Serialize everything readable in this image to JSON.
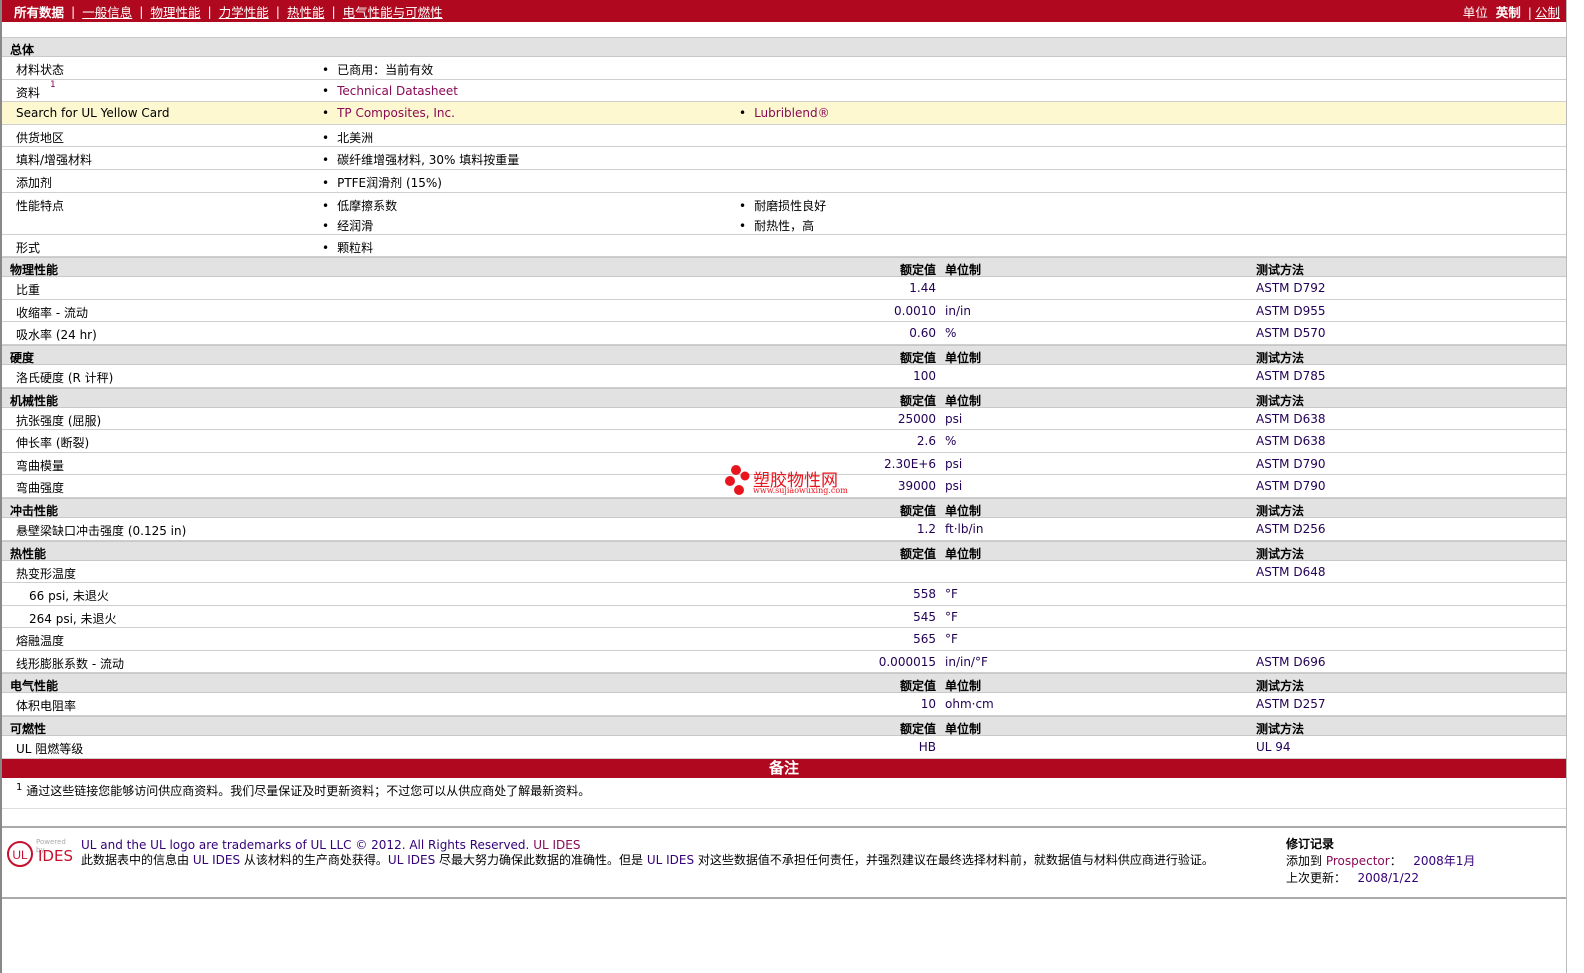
{
  "nav": {
    "all": "所有数据",
    "links": [
      "一般信息",
      "物理性能",
      "力学性能",
      "热性能",
      "电气性能与可燃性"
    ],
    "unit_label": "单位",
    "imperial": "英制",
    "metric": "公制"
  },
  "general": {
    "title": "总体",
    "rows": [
      {
        "label": "材料状态",
        "c1": [
          "已商用：当前有效"
        ]
      },
      {
        "label": "资料",
        "sup": "1",
        "c1": [
          "Technical Datasheet"
        ],
        "link": true
      },
      {
        "label": "Search for UL Yellow Card",
        "c1": [
          "TP Composites, Inc."
        ],
        "c2": [
          "Lubriblend®"
        ],
        "link": true,
        "yellow": true
      },
      {
        "label": "供货地区",
        "c1": [
          "北美洲"
        ]
      },
      {
        "label": "填料/增强材料",
        "c1": [
          "碳纤维增强材料, 30% 填料按重量"
        ]
      },
      {
        "label": "添加剂",
        "c1": [
          "PTFE润滑剂 (15%)"
        ]
      },
      {
        "label": "性能特点",
        "c1": [
          "低摩擦系数",
          "经润滑"
        ],
        "c2": [
          "耐磨损性良好",
          "耐热性，高"
        ]
      },
      {
        "label": "形式",
        "c1": [
          "颗粒料"
        ]
      }
    ]
  },
  "col_headers": {
    "value": "额定值",
    "unit": "单位制",
    "method": "测试方法"
  },
  "sections": [
    {
      "title": "物理性能",
      "rows": [
        {
          "label": "比重",
          "value": "1.44",
          "unit": "",
          "method": "ASTM D792"
        },
        {
          "label": "收缩率 - 流动",
          "value": "0.0010",
          "unit": "in/in",
          "method": "ASTM D955"
        },
        {
          "label": "吸水率 (24 hr)",
          "value": "0.60",
          "unit": "%",
          "method": "ASTM D570"
        }
      ]
    },
    {
      "title": "硬度",
      "rows": [
        {
          "label": "洛氏硬度 (R 计秤)",
          "value": "100",
          "unit": "",
          "method": "ASTM D785"
        }
      ]
    },
    {
      "title": "机械性能",
      "rows": [
        {
          "label": "抗张强度 (屈服)",
          "value": "25000",
          "unit": "psi",
          "method": "ASTM D638"
        },
        {
          "label": "伸长率 (断裂)",
          "value": "2.6",
          "unit": "%",
          "method": "ASTM D638"
        },
        {
          "label": "弯曲模量",
          "value": "2.30E+6",
          "unit": "psi",
          "method": "ASTM D790"
        },
        {
          "label": "弯曲强度",
          "value": "39000",
          "unit": "psi",
          "method": "ASTM D790"
        }
      ]
    },
    {
      "title": "冲击性能",
      "rows": [
        {
          "label": "悬壁梁缺口冲击强度 (0.125 in)",
          "value": "1.2",
          "unit": "ft·lb/in",
          "method": "ASTM D256"
        }
      ]
    },
    {
      "title": "热性能",
      "rows": [
        {
          "label": "热变形温度",
          "value": "",
          "unit": "",
          "method": "ASTM D648"
        },
        {
          "label": "66 psi, 未退火",
          "value": "558",
          "unit": "°F",
          "method": "",
          "indent": true
        },
        {
          "label": "264 psi, 未退火",
          "value": "545",
          "unit": "°F",
          "method": "",
          "indent": true
        },
        {
          "label": "熔融温度",
          "value": "565",
          "unit": "°F",
          "method": ""
        },
        {
          "label": "线形膨胀系数 - 流动",
          "value": "0.000015",
          "unit": "in/in/°F",
          "method": "ASTM D696"
        }
      ]
    },
    {
      "title": "电气性能",
      "rows": [
        {
          "label": "体积电阻率",
          "value": "10",
          "unit": "ohm·cm",
          "method": "ASTM D257"
        }
      ]
    },
    {
      "title": "可燃性",
      "rows": [
        {
          "label": "UL 阻燃等级",
          "value": "HB",
          "unit": "",
          "method": "UL 94"
        }
      ]
    }
  ],
  "notes": {
    "title": "备注",
    "sup": "1",
    "text": "通过这些链接您能够访问供应商资料。我们尽量保证及时更新资料；不过您可以从供应商处了解最新资料。"
  },
  "watermark": {
    "name": "塑胶物性网",
    "url": "www.sujiaowuxing.com"
  },
  "footer": {
    "logo_powered": "Powered by",
    "logo_ides": "IDES",
    "logo_ul": "UL",
    "trademark": "UL and the UL logo are trademarks of UL LLC © 2012. All Rights Reserved.",
    "ul_ides": "UL IDES",
    "disclaimer_a": "此数据表中的信息由 ",
    "disclaimer_b": " 从该材料的生产商处获得。",
    "disclaimer_c": " 尽最大努力确保此数据的准确性。但是 ",
    "disclaimer_d": " 对这些数据值不承担任何责任，并强烈建议在最终选择材料前，就数据值与材料供应商进行验证。",
    "rev_title": "修订记录",
    "added_label": "添加到",
    "prospector": "Prospector",
    "added_colon": "：",
    "added_date": "2008年1月",
    "updated_label": "上次更新：",
    "updated_date": "2008/1/22"
  }
}
